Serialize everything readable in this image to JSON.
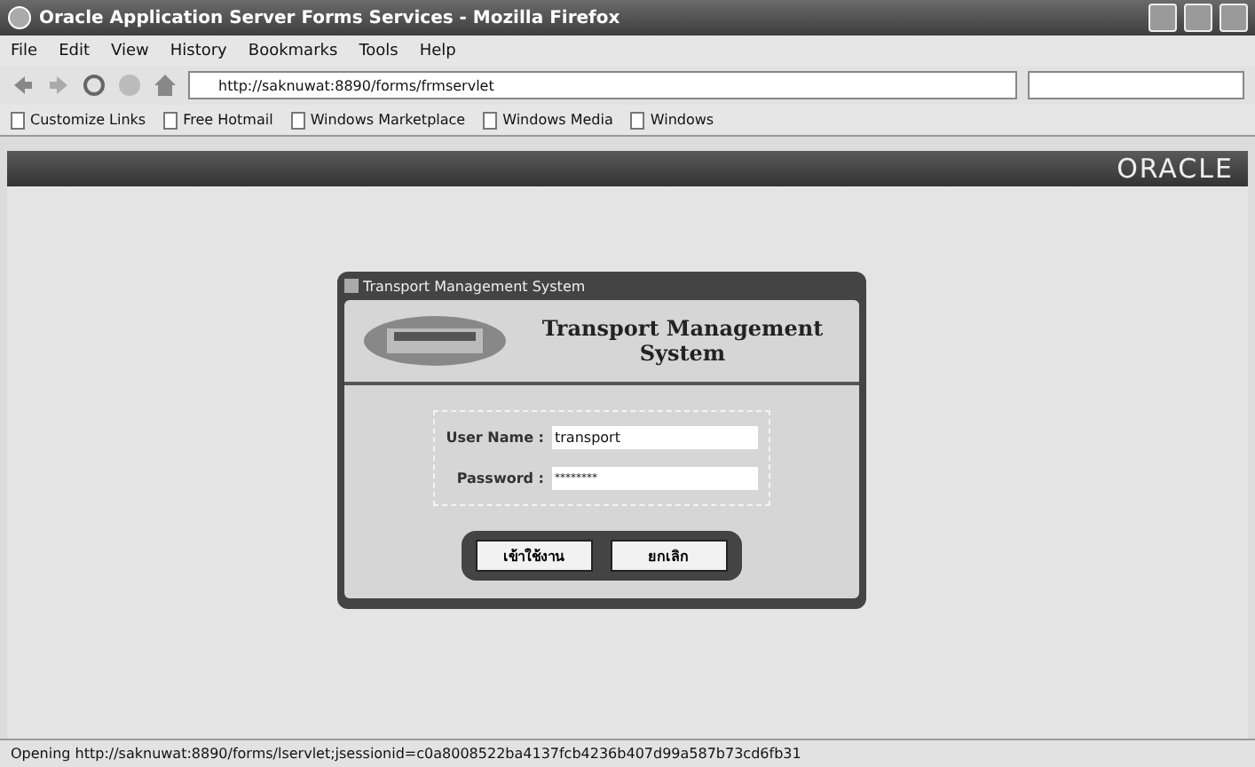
{
  "window": {
    "title": "Oracle Application Server Forms Services - Mozilla Firefox"
  },
  "menu": [
    "File",
    "Edit",
    "View",
    "History",
    "Bookmarks",
    "Tools",
    "Help"
  ],
  "address": {
    "value": "http://saknuwat:8890/forms/frmservlet"
  },
  "bookmarks": [
    "Customize Links",
    "Free Hotmail",
    "Windows Marketplace",
    "Windows Media",
    "Windows"
  ],
  "applet_bar": {
    "logo": "ORACLE"
  },
  "dialog": {
    "title": "Transport Management System",
    "heading": "Transport Management System",
    "fields": [
      {
        "label": "User Name :",
        "value": "transport",
        "masked": false
      },
      {
        "label": "Password :",
        "value": "********",
        "masked": true
      }
    ],
    "buttons": [
      "เข้าใช้งาน",
      "ยกเลิก"
    ]
  },
  "status_bar": "Opening http://saknuwat:8890/forms/lservlet;jsessionid=c0a8008522ba4137fcb4236b407d99a587b73cd6fb31"
}
